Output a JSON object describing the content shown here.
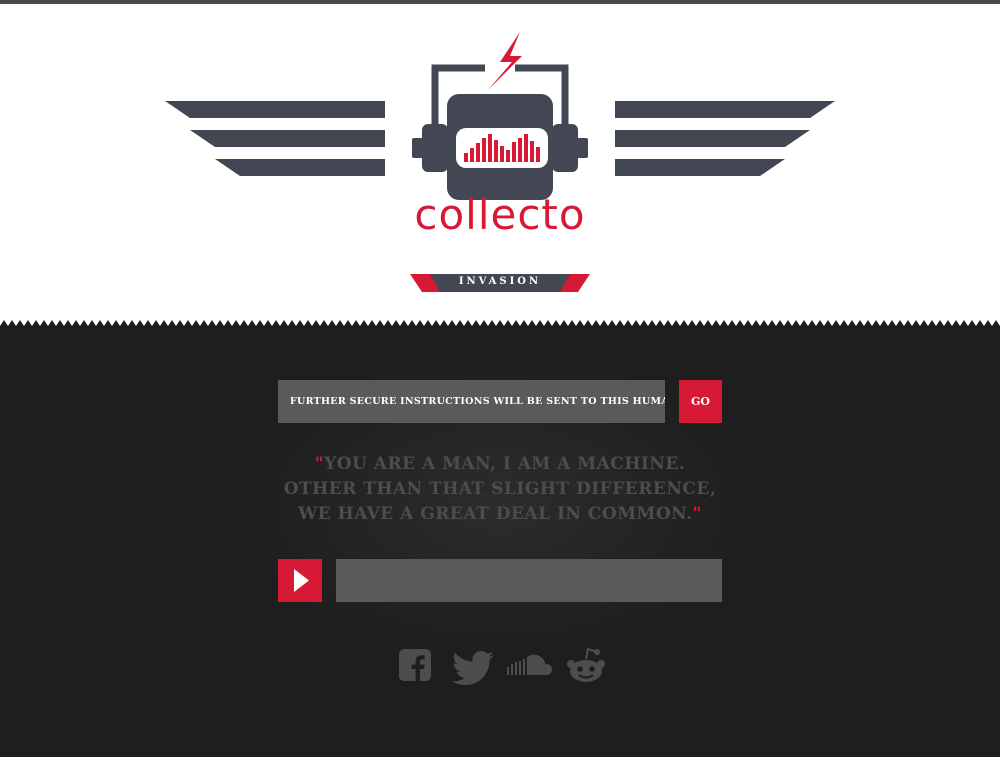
{
  "brand": {
    "name": "collecto",
    "subtitle": "INVASION",
    "colors": {
      "accent": "#d61a36",
      "navy": "#434753",
      "dark_bg": "#1e1e1f",
      "field_bg": "#5a5a5a"
    }
  },
  "signup": {
    "email_placeholder": "FURTHER SECURE INSTRUCTIONS WILL BE SENT TO THIS HUMAN E-ADDRESS",
    "go_label": "GO"
  },
  "quote": {
    "open_mark": "\"",
    "line1": "YOU ARE A MAN, I AM A MACHINE.",
    "line2": "OTHER THAN THAT SLIGHT DIFFERENCE,",
    "line3": "WE HAVE A GREAT DEAL IN COMMON.",
    "close_mark": "\""
  },
  "player": {
    "play_icon": "play-icon",
    "progress": 0
  },
  "social": [
    {
      "icon": "facebook-icon"
    },
    {
      "icon": "twitter-icon"
    },
    {
      "icon": "soundcloud-icon"
    },
    {
      "icon": "reddit-icon"
    }
  ]
}
